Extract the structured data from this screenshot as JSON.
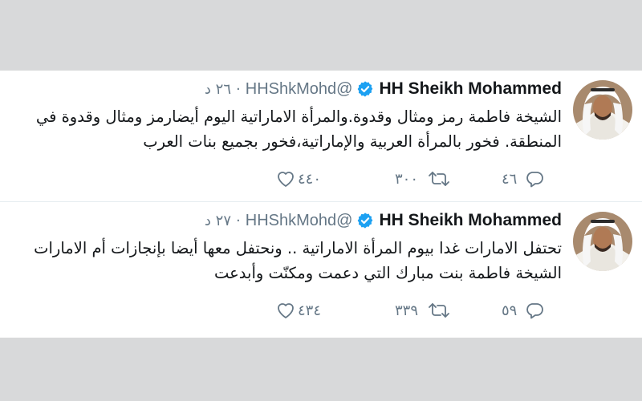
{
  "colors": {
    "text": "#14171a",
    "muted": "#657786",
    "verified": "#1da1f2",
    "background": "#d8d9da"
  },
  "tweets": [
    {
      "author_name": "HH Sheikh Mohammed",
      "verified_icon": "verified-badge-icon",
      "handle": "@HHShkMohd",
      "separator": "·",
      "time": "٢٦ د",
      "lines": [
        "الشيخة فاطمة رمز ومثال وقدوة.والمرأة الاماراتية اليوم أيضارمز ومثال وقدوة في",
        "المنطقة. فخور بالمرأة العربية والإماراتية،فخور بجميع بنات العرب"
      ],
      "replies": "٤٦",
      "retweets": "٣٠٠",
      "likes": "٤٤٠"
    },
    {
      "author_name": "HH Sheikh Mohammed",
      "verified_icon": "verified-badge-icon",
      "handle": "@HHShkMohd",
      "separator": "·",
      "time": "٢٧ د",
      "lines": [
        "تحتفل الامارات غدا بيوم المرأة الاماراتية .. ونحتفل معها أيضا بإنجازات أم الامارات",
        "الشيخة فاطمة بنت مبارك التي دعمت ومكنّت وأبدعت"
      ],
      "replies": "٥٩",
      "retweets": "٣٣٩",
      "likes": "٤٣٤"
    }
  ]
}
